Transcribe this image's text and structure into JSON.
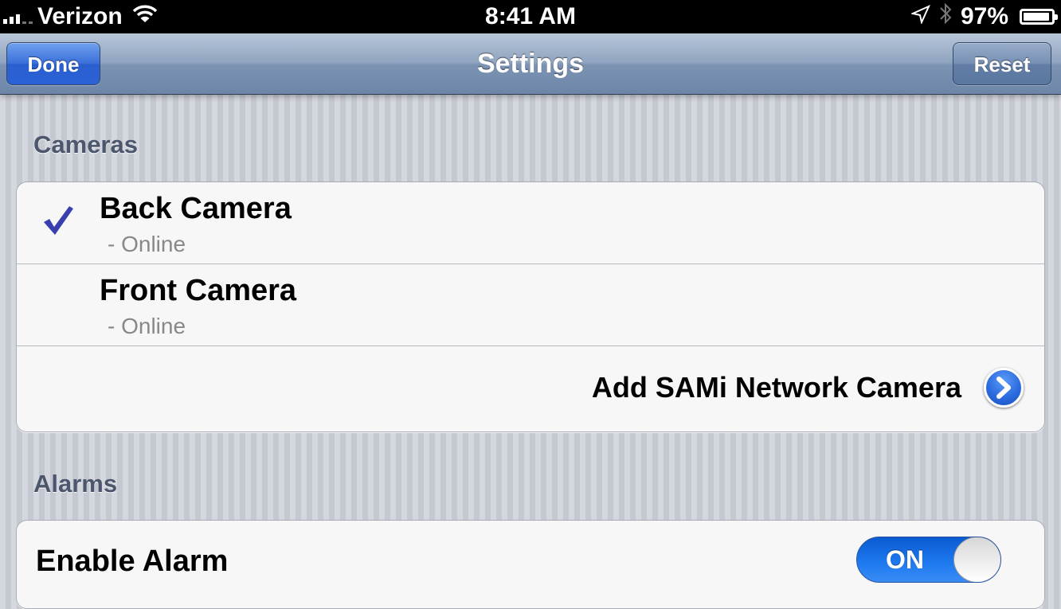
{
  "status_bar": {
    "carrier": "Verizon",
    "time": "8:41 AM",
    "battery_percent": "97%",
    "icons": [
      "signal-icon",
      "wifi-icon",
      "location-icon",
      "bluetooth-icon",
      "battery-icon"
    ]
  },
  "nav": {
    "title": "Settings",
    "left_button": "Done",
    "right_button": "Reset"
  },
  "cameras": {
    "header": "Cameras",
    "items": [
      {
        "name": "Back Camera",
        "status": "- Online",
        "selected": true
      },
      {
        "name": "Front Camera",
        "status": "- Online",
        "selected": false
      }
    ],
    "add_label": "Add SAMi Network Camera"
  },
  "alarms": {
    "header": "Alarms",
    "enable_label": "Enable Alarm",
    "toggle_label": "ON",
    "toggle_state": true
  },
  "colors": {
    "checkmark": "#3a3fb0",
    "toggle_on": "#1f7af0",
    "done_button": "#2b62d6",
    "nav_bar": "#7c93b3"
  }
}
